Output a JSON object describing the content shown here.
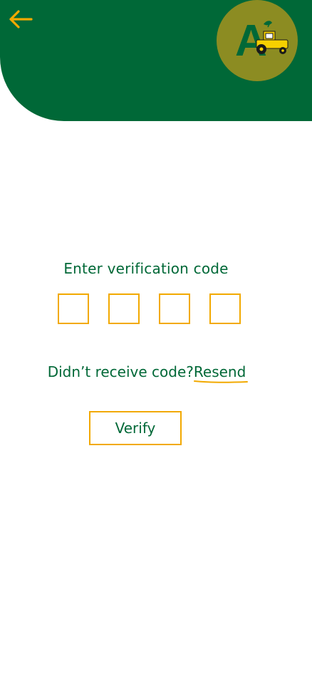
{
  "header": {
    "back_icon": "arrow-left-icon",
    "logo_letter": "A",
    "logo_icon": "tractor-icon",
    "colors": {
      "background": "#006837",
      "accent": "#f2a900",
      "logo_circle": "#8c8c22"
    }
  },
  "verification": {
    "title": "Enter verification code",
    "code_inputs": [
      "",
      "",
      "",
      ""
    ],
    "resend_prompt": "Didn’t receive code?",
    "resend_link": "Resend",
    "verify_label": "Verify"
  }
}
